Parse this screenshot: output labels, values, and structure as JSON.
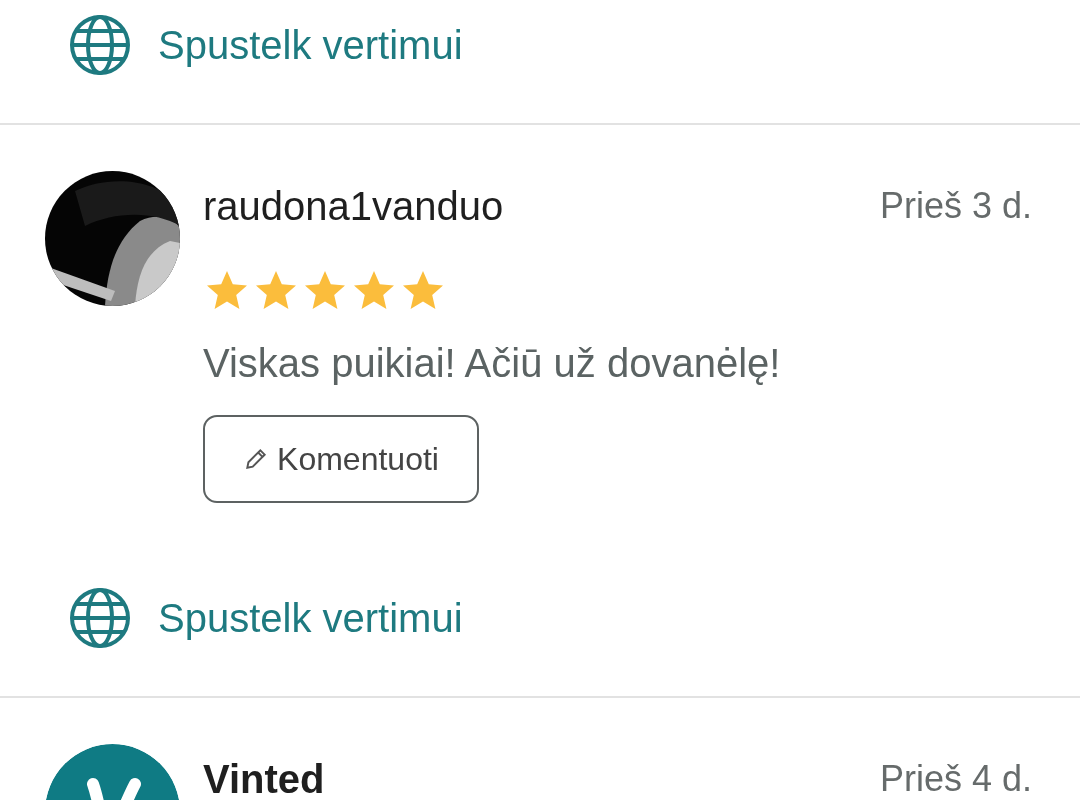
{
  "items": [
    {
      "kind": "translate",
      "label": "Spustelk vertimui"
    },
    {
      "kind": "review",
      "username": "raudona1vanduo",
      "time": "Prieš 3 d.",
      "stars": 5,
      "comment": "Viskas puikiai! Ačiū už dovanėlę!",
      "reply_button": "Komentuoti"
    },
    {
      "kind": "translate",
      "label": "Spustelk vertimui"
    },
    {
      "kind": "review",
      "avatar": {
        "kind": "logo"
      },
      "username": "Vinted",
      "time": "Prieš 4 d."
    }
  ]
}
